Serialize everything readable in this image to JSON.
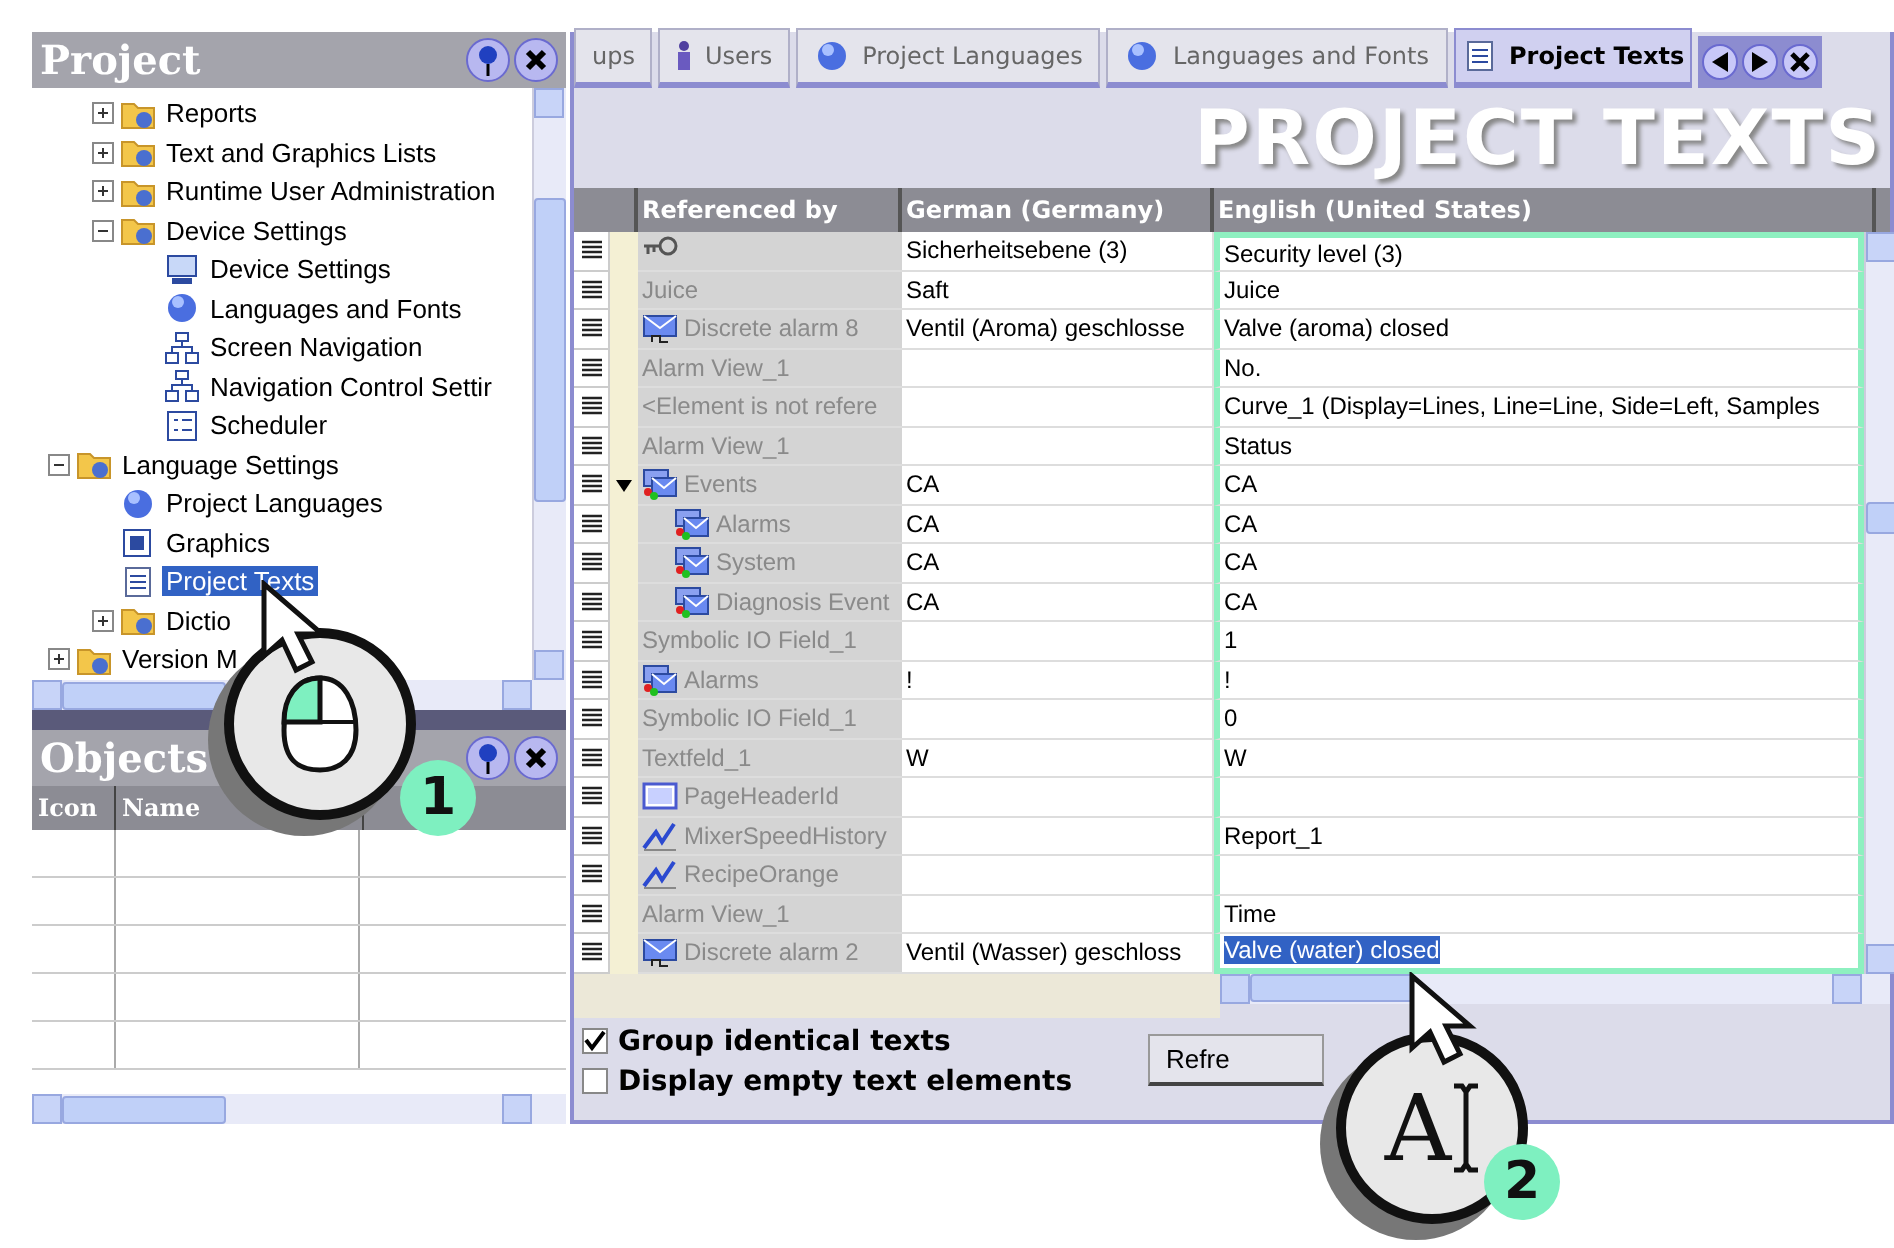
{
  "project_panel": {
    "title": "Project",
    "tree": {
      "hidden_parent_children": [
        {
          "label": "Reports",
          "kind": "folder",
          "expanded": false,
          "selected": false
        },
        {
          "label": "Text and Graphics Lists",
          "kind": "folder",
          "expanded": false,
          "selected": false
        },
        {
          "label": "Runtime User Administration",
          "kind": "folder",
          "expanded": false,
          "selected": false
        },
        {
          "label": "Device Settings",
          "kind": "folder",
          "expanded": true,
          "selected": false,
          "children": [
            {
              "label": "Device Settings",
              "kind": "monitor",
              "selected": false
            },
            {
              "label": "Languages and Fonts",
              "kind": "globe",
              "selected": false
            },
            {
              "label": "Screen Navigation",
              "kind": "network",
              "selected": false
            },
            {
              "label": "Navigation Control Settir",
              "kind": "network",
              "selected": false
            },
            {
              "label": "Scheduler",
              "kind": "list",
              "selected": false
            }
          ]
        }
      ],
      "items": [
        {
          "label": "Language Settings",
          "kind": "folder",
          "expanded": true,
          "selected": false,
          "children": [
            {
              "label": "Project Languages",
              "kind": "globe",
              "selected": false
            },
            {
              "label": "Graphics",
              "kind": "graphics",
              "selected": false
            },
            {
              "label": "Project Texts",
              "kind": "document",
              "selected": true
            },
            {
              "label": "Dictio",
              "kind": "folder",
              "expanded": false,
              "selected": false
            }
          ]
        },
        {
          "label": "Version M",
          "kind": "folder",
          "expanded": false,
          "selected": false
        }
      ]
    }
  },
  "objects_panel": {
    "title": "Objects",
    "columns": [
      "Icon",
      "Name"
    ]
  },
  "editor": {
    "tabs": [
      {
        "label": "ups",
        "kind": "none",
        "selected": false
      },
      {
        "label": "Users",
        "kind": "user",
        "selected": false
      },
      {
        "label": "Project Languages",
        "kind": "globe",
        "selected": false
      },
      {
        "label": "Languages and Fonts",
        "kind": "globe",
        "selected": false
      },
      {
        "label": "Project Texts",
        "kind": "document",
        "selected": true
      }
    ],
    "heading": "PROJECT TEXTS",
    "table": {
      "columns": [
        "Referenced by",
        "German (Germany)",
        "English (United States)"
      ],
      "rows": [
        {
          "kind": "key",
          "referenced_by": "",
          "german": "Sicherheitsebene (3)",
          "english": "Security level (3)",
          "selected": false
        },
        {
          "kind": "plain",
          "referenced_by": "Juice",
          "german": "Saft",
          "english": "Juice",
          "selected": false
        },
        {
          "kind": "alarm",
          "referenced_by": "Discrete alarm 8",
          "german": "Ventil (Aroma) geschlosse",
          "english": "Valve (aroma) closed",
          "selected": false
        },
        {
          "kind": "plain",
          "referenced_by": "Alarm View_1",
          "german": "",
          "english": "No.",
          "selected": false
        },
        {
          "kind": "plain",
          "referenced_by": "<Element is not refere",
          "german": "",
          "english": "Curve_1 (Display=Lines, Line=Line, Side=Left, Samples",
          "selected": false
        },
        {
          "kind": "plain",
          "referenced_by": "Alarm View_1",
          "german": "",
          "english": "Status",
          "selected": false
        },
        {
          "kind": "events",
          "referenced_by": "Events",
          "german": "CA",
          "english": "CA",
          "selected": false,
          "expanded": true,
          "children": [
            {
              "kind": "events",
              "referenced_by": "Alarms",
              "german": "CA",
              "english": "CA",
              "selected": false
            },
            {
              "kind": "events",
              "referenced_by": "System",
              "german": "CA",
              "english": "CA",
              "selected": false
            },
            {
              "kind": "events",
              "referenced_by": "Diagnosis Event",
              "german": "CA",
              "english": "CA",
              "selected": false
            }
          ]
        },
        {
          "kind": "plain",
          "referenced_by": "Symbolic IO Field_1",
          "german": "",
          "english": "1",
          "selected": false
        },
        {
          "kind": "events",
          "referenced_by": "Alarms",
          "german": "!",
          "english": "!",
          "selected": false
        },
        {
          "kind": "plain",
          "referenced_by": "Symbolic IO Field_1",
          "german": "",
          "english": "0",
          "selected": false
        },
        {
          "kind": "plain",
          "referenced_by": "Textfeld_1",
          "german": "W",
          "english": "W",
          "selected": false
        },
        {
          "kind": "page",
          "referenced_by": "PageHeaderId",
          "german": "",
          "english": "",
          "selected": false
        },
        {
          "kind": "trend",
          "referenced_by": "MixerSpeedHistory",
          "german": "",
          "english": "Report_1",
          "selected": false
        },
        {
          "kind": "trend",
          "referenced_by": "RecipeOrange",
          "german": "",
          "english": "",
          "selected": false
        },
        {
          "kind": "plain",
          "referenced_by": "Alarm View_1",
          "german": "",
          "english": "Time",
          "selected": false
        },
        {
          "kind": "alarm",
          "referenced_by": "Discrete alarm 2",
          "german": "Ventil (Wasser) geschloss",
          "english": "Valve (water) closed",
          "selected": true
        }
      ]
    },
    "options": [
      {
        "label": "Group identical texts",
        "checked": true
      },
      {
        "label": "Display empty text elements",
        "checked": false
      }
    ],
    "refresh_button": "Refre"
  },
  "callouts": [
    {
      "number": "1",
      "kind": "mouse"
    },
    {
      "number": "2",
      "kind": "text-cursor",
      "glyph": "A"
    }
  ]
}
